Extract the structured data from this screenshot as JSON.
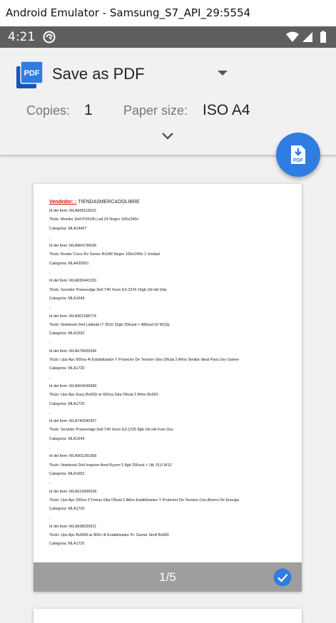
{
  "window": {
    "title": "Android Emulator - Samsung_S7_API_29:5554"
  },
  "status_bar": {
    "time": "4:21"
  },
  "print_header": {
    "destination": "Save as PDF",
    "copies_label": "Copies:",
    "copies_value": "1",
    "paper_size_label": "Paper size:",
    "paper_size_value": "ISO A4"
  },
  "colors": {
    "accent": "#2f7de1",
    "vendor_red": "#cc1111",
    "status_bar": "#5f5f5f"
  },
  "preview": {
    "page_indicator": "1/5",
    "vendor_label": "Vendedor: :",
    "vendor_name": "TIENDASMERCADOLIBRE",
    "items": [
      {
        "id": "Id del Item: MLA843116615",
        "title": "Titulo: Monitor Dell P2419h Led 24 Negro 100v/240v",
        "category": "Categoria: MLA14407"
      },
      {
        "id": "Id del Item: MLA864736036",
        "title": "Titulo: Router Cisco Rv Series Rv340 Negro 100v/240v 1 Unidad",
        "category": "Categoria: MLA430901"
      },
      {
        "id": "Id del Item: MLA830441150",
        "title": "Titulo: Servidor Poweredge Dell T40 Xeon E3-2224 16gb 1tb Hd Gtia",
        "category": "Categoria: MLA1649"
      },
      {
        "id": "Id del Item: MLA901188774",
        "title": "Titulo: Notebook Dell Latitude I7 3510 32gb 256ssd + 480ssd Gf W10p",
        "category": "Categoria: MLA1652"
      },
      {
        "id": "Id del Item: MLA679009346",
        "title": "Titulo: Ups Apc 800va 4t Estabilizador Y Protector De Tension Gtia Oficial 2 Años Similar Ideal Para Uso Gamer",
        "category": "Categoria: MLA1720"
      },
      {
        "id": "Id del Item: MLA604049998",
        "title": "Titulo: Ups Apc Easy Bv650i ar 650va Gtia Oficial 2 Años Bv650",
        "category": "Categoria: MLA1720"
      },
      {
        "id": "Id del Item: MLA740540307",
        "title": "Titulo: Servidor Poweredge Dell T40 Xeon E3-1225 8gb 1tb Hd Free Dos",
        "category": "Categoria: MLA1649"
      },
      {
        "id": "Id del Item: MLA901281068",
        "title": "Titulo: Notebook Dell Inspiron Amd Ryzen 5 8gb 256ssd + 1tb 15,6 W10",
        "category": "Categoria: MLA1652"
      },
      {
        "id": "Id del Item: MLA619999038",
        "title": "Titulo: Ups Apc 550va 3 Tomas Gtia Oficial 2 Años Estabilizador Y Protector De Tension Con Ahorro De Energia",
        "category": "Categoria: MLA1720"
      },
      {
        "id": "Id del Item: MLA838039921",
        "title": "Titulo: Ups Apc Bv800i-ar 800v 4t Estabilizador Pc Gamer Simil Bx800",
        "category": "Categoria: MLA1720"
      }
    ]
  }
}
